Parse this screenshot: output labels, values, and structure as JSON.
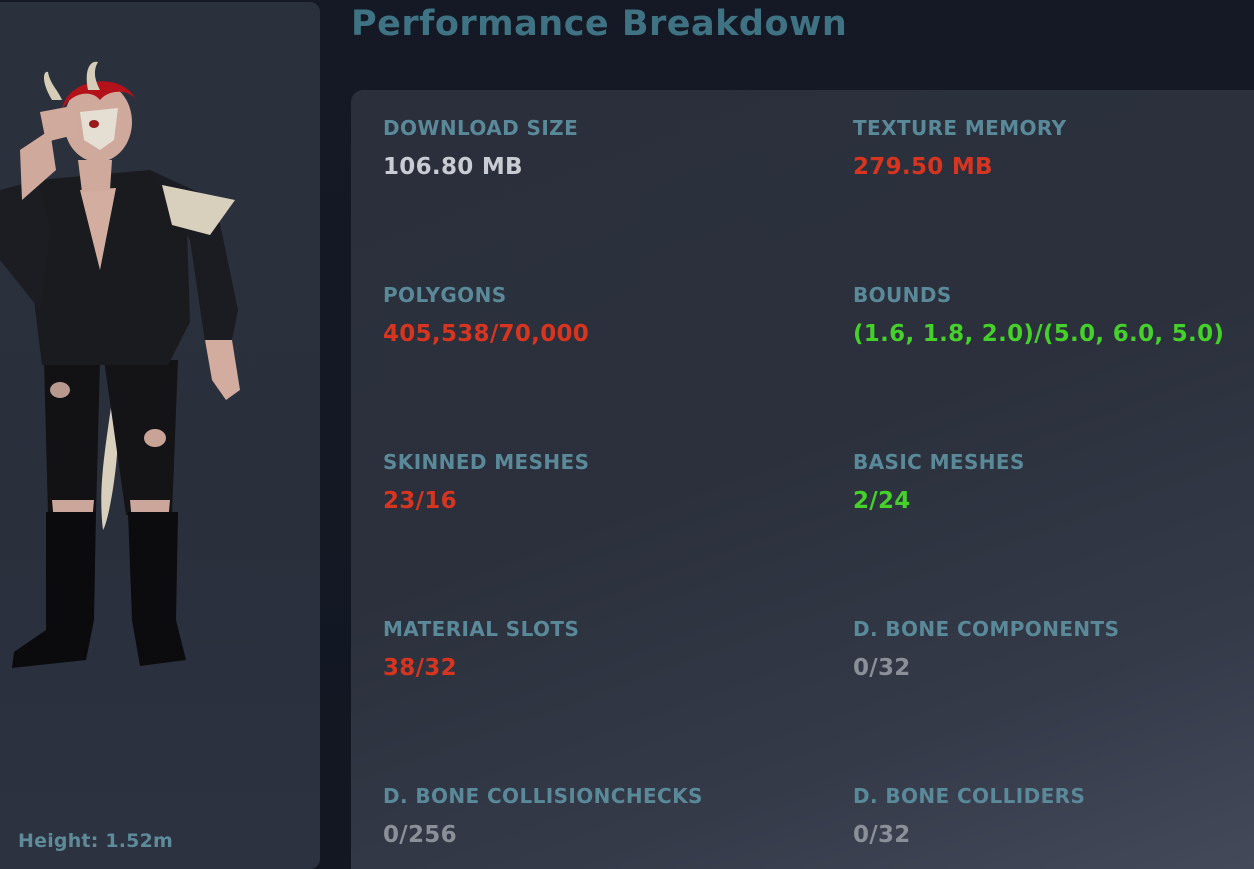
{
  "avatar": {
    "height_label": "Height: 1.52m"
  },
  "header": {
    "title": "Performance Breakdown"
  },
  "stats": [
    {
      "label": "DOWNLOAD SIZE",
      "value": "106.80 MB",
      "status": "neutral"
    },
    {
      "label": "TEXTURE MEMORY",
      "value": "279.50 MB",
      "status": "over"
    },
    {
      "label": "POLYGONS",
      "value": "405,538/70,000",
      "status": "over"
    },
    {
      "label": "BOUNDS",
      "value": "(1.6, 1.8, 2.0)/(5.0, 6.0, 5.0)",
      "status": "ok"
    },
    {
      "label": "SKINNED MESHES",
      "value": "23/16",
      "status": "over"
    },
    {
      "label": "BASIC MESHES",
      "value": "2/24",
      "status": "ok"
    },
    {
      "label": "MATERIAL SLOTS",
      "value": "38/32",
      "status": "over"
    },
    {
      "label": "D. BONE COMPONENTS",
      "value": "0/32",
      "status": "none"
    },
    {
      "label": "D. BONE COLLISIONCHECKS",
      "value": "0/256",
      "status": "none"
    },
    {
      "label": "D. BONE COLLIDERS",
      "value": "0/32",
      "status": "none"
    }
  ],
  "colors": {
    "neutral": "#c9ccd3",
    "over": "#d83520",
    "ok": "#46d02a",
    "none": "#8b8f97",
    "label": "#5a8a9a",
    "title": "#3f7384"
  }
}
